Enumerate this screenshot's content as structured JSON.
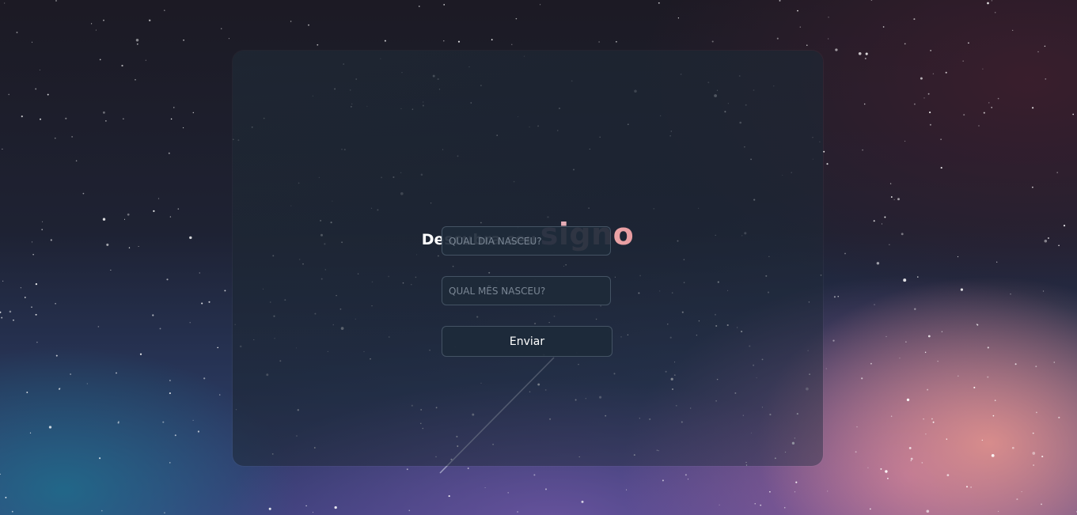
{
  "background": {
    "description_icon": "starry-sky-background"
  },
  "card": {
    "title_prefix": "Descubra seu",
    "title_accent": "signo"
  },
  "form": {
    "day_placeholder": "QUAL DIA NASCEU?",
    "month_placeholder": "QUAL MÊS NASCEU?",
    "day_value": "",
    "month_value": "",
    "submit_label": "Enviar"
  },
  "colors": {
    "accent_gradient_start": "#d7a0b8",
    "accent_gradient_end": "#e79aa0",
    "card_bg": "#1e2a3a",
    "text": "#ffffff"
  }
}
